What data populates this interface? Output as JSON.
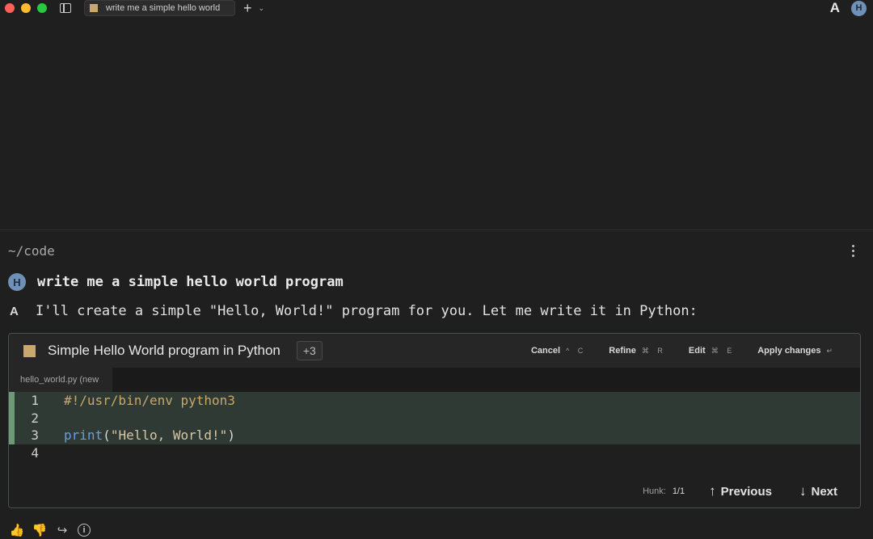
{
  "window": {
    "tab_title": "write me a simple hello world",
    "new_tab": "+",
    "new_tab_menu": "⌄",
    "logo": "A",
    "avatar_initial": "H"
  },
  "session": {
    "cwd": "~/code"
  },
  "conversation": {
    "user_message": "write me a simple hello world program",
    "user_avatar_initial": "H",
    "ai_icon": "A",
    "ai_message": "I'll create a simple \"Hello, World!\" program for you. Let me write it in Python:"
  },
  "diff_panel": {
    "title": "Simple Hello World program in Python",
    "more_badge": "+3",
    "actions": [
      {
        "label": "Cancel",
        "shortcut": "^ C"
      },
      {
        "label": "Refine",
        "shortcut": "⌘ R"
      },
      {
        "label": "Edit",
        "shortcut": "⌘ E"
      },
      {
        "label": "Apply changes",
        "shortcut": "↵"
      }
    ],
    "file_tab": "hello_world.py (new",
    "lines": [
      {
        "num": "1",
        "added": true,
        "text": "#!/usr/bin/env python3"
      },
      {
        "num": "2",
        "added": true,
        "text": ""
      },
      {
        "num": "3",
        "added": true,
        "fn": "print",
        "open": "(",
        "str": "\"Hello, World!\"",
        "close": ")"
      },
      {
        "num": "4",
        "added": false,
        "text": ""
      }
    ],
    "hunk_label": "Hunk:",
    "hunk_count": "1/1",
    "previous_label": "Previous",
    "previous_arrow": "↑",
    "next_label": "Next",
    "next_arrow": "↓"
  },
  "feedback": {
    "thumbs_up": "👍",
    "thumbs_down": "👎",
    "share": "↪",
    "info": "i"
  },
  "colors": {
    "background": "#1f1f1f",
    "added_line_bg": "#2f3a34",
    "added_gutter": "#6c9a77",
    "file_square": "#c9a86b",
    "avatar": "#6f91b8"
  }
}
